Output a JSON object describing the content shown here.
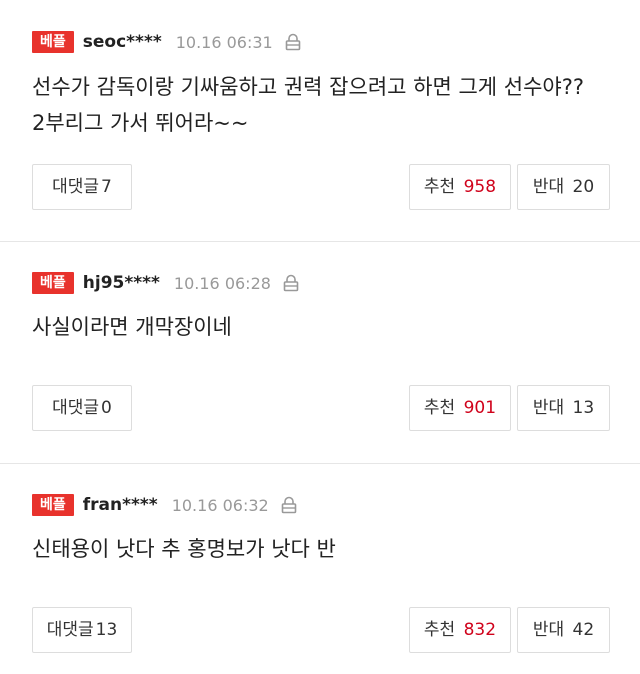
{
  "comments": [
    {
      "badge": "베플",
      "nick": "seoc****",
      "time": "10.16 06:31",
      "lines": [
        "선수가 감독이랑 기싸움하고 권력 잡으려고 하면 그게 선수야??",
        "2부리그 가서 뛰어라~~"
      ],
      "reply_label": "대댓글",
      "reply_count": "7",
      "rec_label": "추천",
      "rec_count": "958",
      "opp_label": "반대",
      "opp_count": "20"
    },
    {
      "badge": "베플",
      "nick": "hj95****",
      "time": "10.16 06:28",
      "lines": [
        "사실이라면 개막장이네"
      ],
      "reply_label": "대댓글",
      "reply_count": "0",
      "rec_label": "추천",
      "rec_count": "901",
      "opp_label": "반대",
      "opp_count": "13"
    },
    {
      "badge": "베플",
      "nick": "fran****",
      "time": "10.16 06:32",
      "lines": [
        "신태용이 낫다 추 홍명보가 낫다 반"
      ],
      "reply_label": "대댓글",
      "reply_count": "13",
      "rec_label": "추천",
      "rec_count": "832",
      "opp_label": "반대",
      "opp_count": "42"
    }
  ],
  "colors": {
    "badge": "#e8322c",
    "recommend_count": "#d0021b"
  },
  "icons": {
    "lock": "lock-icon"
  }
}
